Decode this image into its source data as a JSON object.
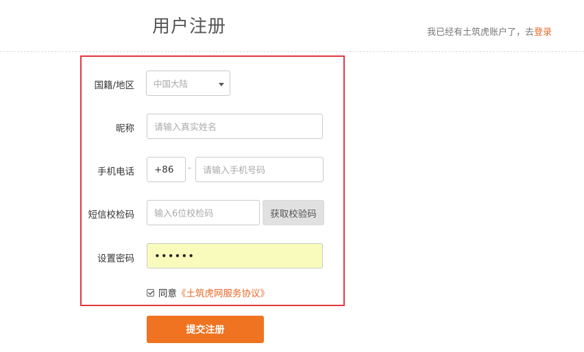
{
  "header": {
    "title": "用户注册",
    "login_hint_prefix": "我已经有土筑虎账户了，去",
    "login_link": "登录"
  },
  "form": {
    "nationality": {
      "label": "国籍/地区",
      "value": "中国大陆"
    },
    "nickname": {
      "label": "昵称",
      "placeholder": "请输入真实姓名"
    },
    "phone": {
      "label": "手机电话",
      "country_code": "+86",
      "separator": "-",
      "placeholder": "请输入手机号码"
    },
    "sms_code": {
      "label": "短信校检码",
      "placeholder": "输入6位校检码",
      "button_label": "获取校验码"
    },
    "password": {
      "label": "设置密码",
      "value": "••••••"
    },
    "agreement": {
      "checked": true,
      "text": "同意",
      "link": "《土筑虎网服务协议》"
    }
  },
  "submit_label": "提交注册",
  "colors": {
    "accent": "#ef7320",
    "link": "#e8692a",
    "highlight_frame": "#e4353b",
    "autofill": "#f9fbbd"
  }
}
